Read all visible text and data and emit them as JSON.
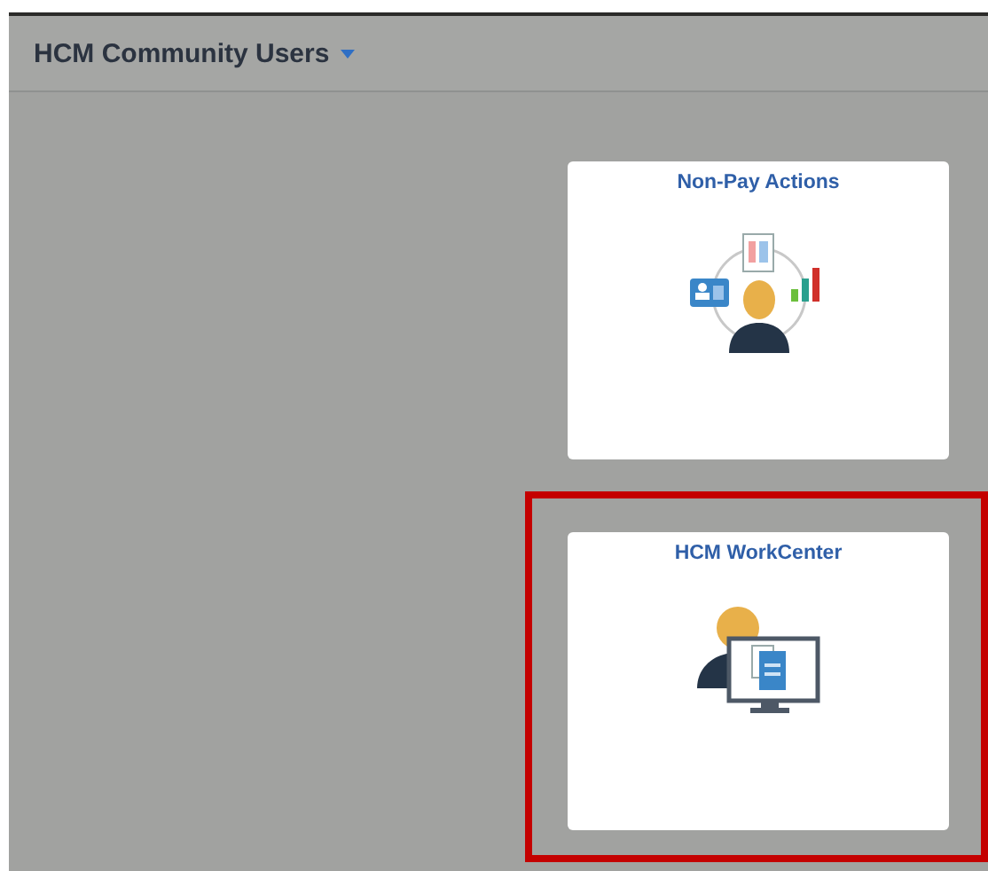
{
  "header": {
    "title": "HCM Community Users"
  },
  "tiles": [
    {
      "title": "Non-Pay Actions",
      "kind": "nonpay",
      "highlighted": false
    },
    {
      "title": "HCM WorkCenter",
      "kind": "workcenter",
      "highlighted": true
    }
  ]
}
